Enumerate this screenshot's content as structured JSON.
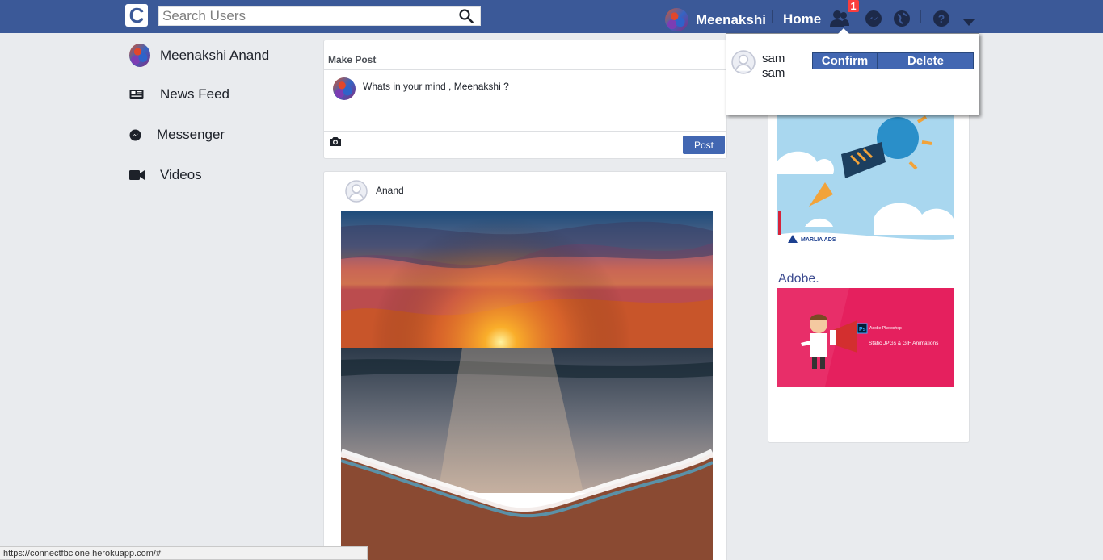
{
  "app": {
    "logo_letter": "C"
  },
  "search": {
    "placeholder": "Search Users"
  },
  "nav": {
    "user_name": "Meenakshi",
    "home_label": "Home",
    "friend_request_count": "1"
  },
  "sidebar": {
    "items": [
      {
        "label": "Meenakshi Anand",
        "icon": "avatar"
      },
      {
        "label": "News Feed",
        "icon": "newspaper-icon"
      },
      {
        "label": "Messenger",
        "icon": "messenger-icon"
      },
      {
        "label": "Videos",
        "icon": "video-camera-icon"
      }
    ]
  },
  "make_post": {
    "title": "Make Post",
    "prompt": "Whats in your mind , Meenakshi ?",
    "post_button": "Post"
  },
  "feed": {
    "posts": [
      {
        "author": "Anand",
        "image": "sunset over ocean waves on beach"
      }
    ]
  },
  "ads": {
    "ad1_brand": "MARLIA ADS",
    "adobe_label": "Adobe.",
    "ad2_text_brand": "Adobe Photoshop",
    "ad2_text_desc": "Static JPGs & GIF Animations"
  },
  "friend_requests": {
    "items": [
      {
        "name": "sam sam",
        "confirm_label": "Confirm",
        "delete_label": "Delete"
      }
    ]
  },
  "status_bar": {
    "url": "https://connectfbclone.herokuapp.com/#"
  },
  "colors": {
    "brand": "#3b5998",
    "button": "#4267b2",
    "badge": "#fa3e3e",
    "background": "#e9ebee"
  }
}
